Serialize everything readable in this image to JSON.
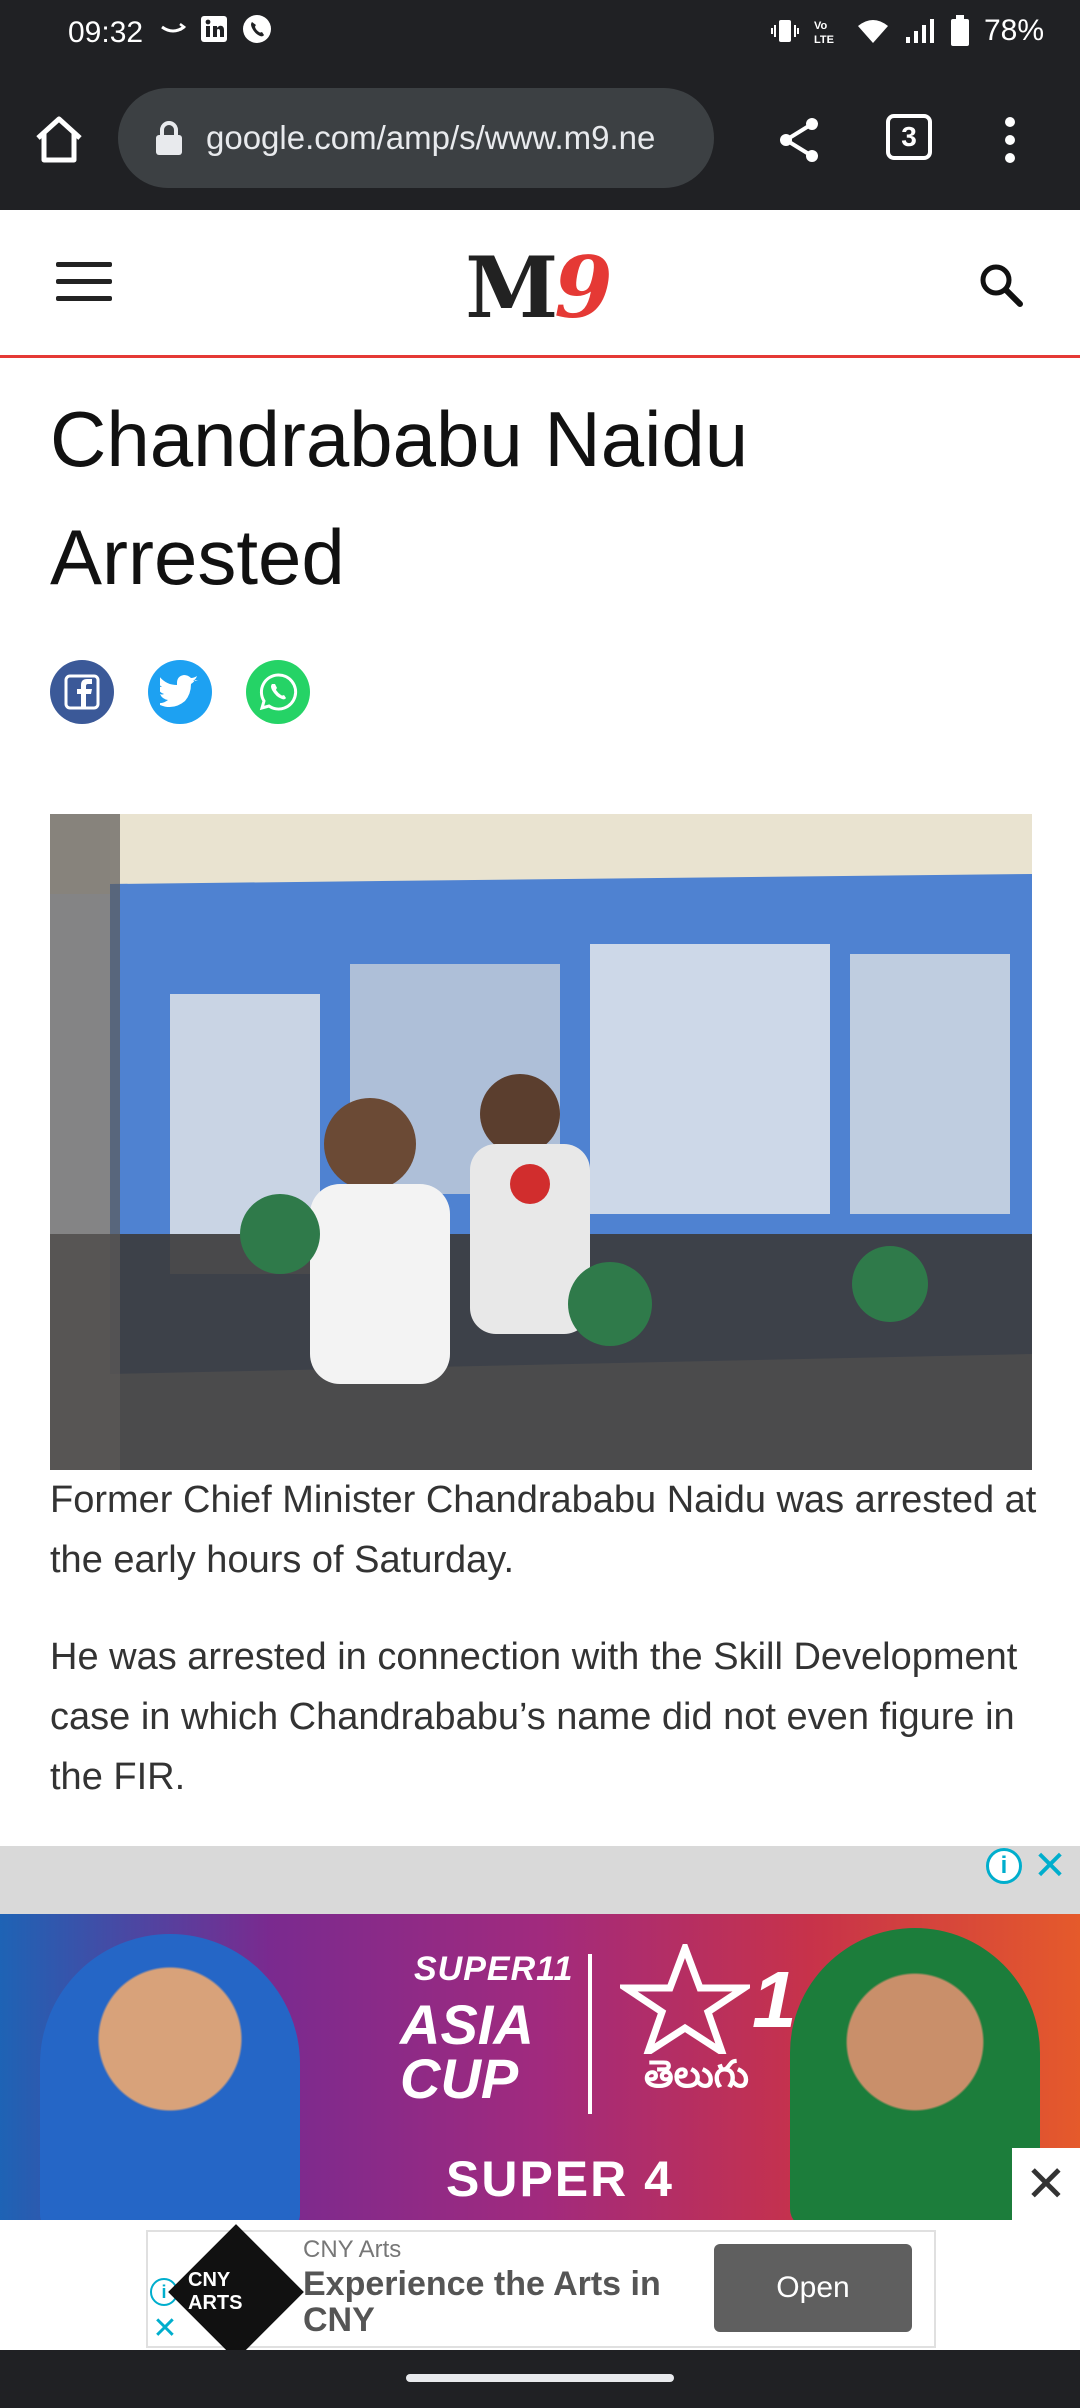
{
  "status_bar": {
    "time": "09:32",
    "battery": "78%",
    "icons_left": [
      "amazon-icon",
      "linkedin-icon",
      "phone-icon"
    ],
    "icons_right": [
      "vibrate-icon",
      "volte-icon",
      "wifi-icon",
      "signal-icon",
      "battery-icon"
    ]
  },
  "browser": {
    "url": "google.com/amp/s/www.m9.ne",
    "tab_count": "3"
  },
  "site": {
    "logo_m": "M",
    "logo_9": "9"
  },
  "article": {
    "title": "Chandrababu Naidu Arrested",
    "caption": "Former Chief Minister Chandrababu Naidu was arrested at the early hours of Saturday.",
    "paragraph": "He was arrested in connection with the Skill Development case in which Chandrababu’s name did not even figure in the FIR."
  },
  "ad_banner": {
    "super11": "SUPER11",
    "event": "ASIA CUP",
    "channel_number": "1",
    "language": "తెలుగు",
    "stage": "SUPER 4"
  },
  "app_ad": {
    "brand": "CNY Arts",
    "headline": "Experience the Arts in CNY",
    "logo_text": "CNY ARTS",
    "cta": "Open"
  },
  "colors": {
    "brand_red": "#e53935",
    "facebook": "#3b5998",
    "twitter": "#1da1f2",
    "whatsapp": "#25d366",
    "adchoices": "#00aecd"
  }
}
